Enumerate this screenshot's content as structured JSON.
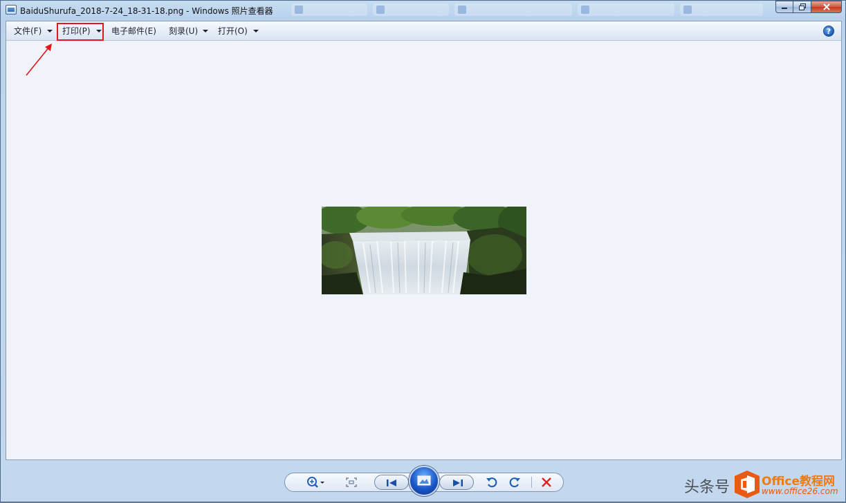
{
  "window": {
    "title": "BaiduShurufa_2018-7-24_18-31-18.png - Windows 照片查看器",
    "caption_buttons": [
      "minimize-icon",
      "maximize-icon",
      "close-icon"
    ]
  },
  "menu": {
    "items": [
      {
        "label": "文件(F)",
        "has_dropdown": true
      },
      {
        "label": "打印(P)",
        "has_dropdown": true,
        "highlighted": true
      },
      {
        "label": "电子邮件(E)",
        "has_dropdown": false
      },
      {
        "label": "刻录(U)",
        "has_dropdown": true
      },
      {
        "label": "打开(O)",
        "has_dropdown": true
      }
    ],
    "help_icon": "help-icon",
    "help_glyph": "?"
  },
  "annotation": {
    "highlight_color": "#e0161c"
  },
  "photo": {
    "subject": "waterfall-image"
  },
  "controls": {
    "icons": [
      "zoom-icon",
      "actual-size-icon",
      "previous-icon",
      "slideshow-icon",
      "next-icon",
      "rotate-left-icon",
      "rotate-right-icon",
      "delete-icon"
    ]
  },
  "watermark": {
    "text": "头条号",
    "brand_latin": "Office",
    "brand_cn": "教程网",
    "url": "www.office26.com"
  }
}
